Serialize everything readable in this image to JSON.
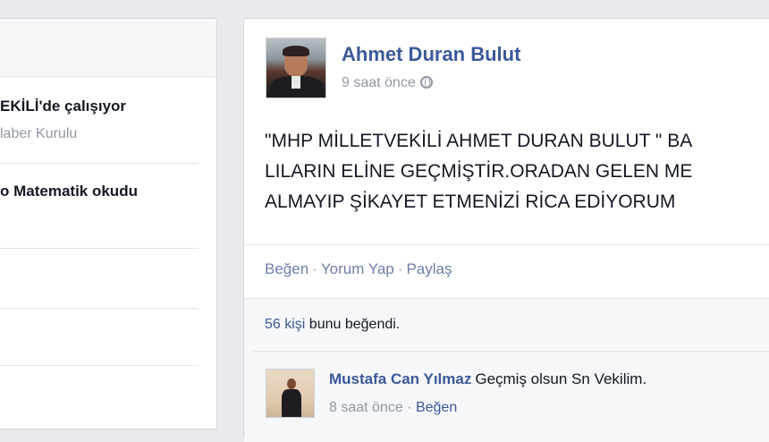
{
  "profile_sidebar": {
    "work": {
      "title": "EKİLİ'de çalışıyor",
      "subtitle": "laber Kurulu"
    },
    "education": {
      "title": "o Matematik okudu"
    }
  },
  "post": {
    "author": "Ahmet Duran Bulut",
    "time": "9 saat önce",
    "text_lines": [
      "\"MHP MİLLETVEKİLİ AHMET DURAN BULUT \" BA",
      "LILARIN ELİNE GEÇMİŞTİR.ORADAN GELEN ME",
      "ALMAYIP ŞİKAYET ETMENİZİ RİCA EDİYORUM"
    ],
    "actions": {
      "like": "Beğen",
      "comment": "Yorum Yap",
      "share": "Paylaş",
      "separator": "·"
    },
    "likes": {
      "count": "56 kişi",
      "suffix": " bunu beğendi."
    },
    "comment": {
      "author": "Mustafa Can Yılmaz",
      "text": "Geçmiş olsun Sn Vekilim.",
      "time": "8 saat önce",
      "separator": " · ",
      "like": "Beğen"
    }
  },
  "colors": {
    "link": "#3b5998",
    "muted": "#9197a3",
    "background": "#e9eaed"
  }
}
